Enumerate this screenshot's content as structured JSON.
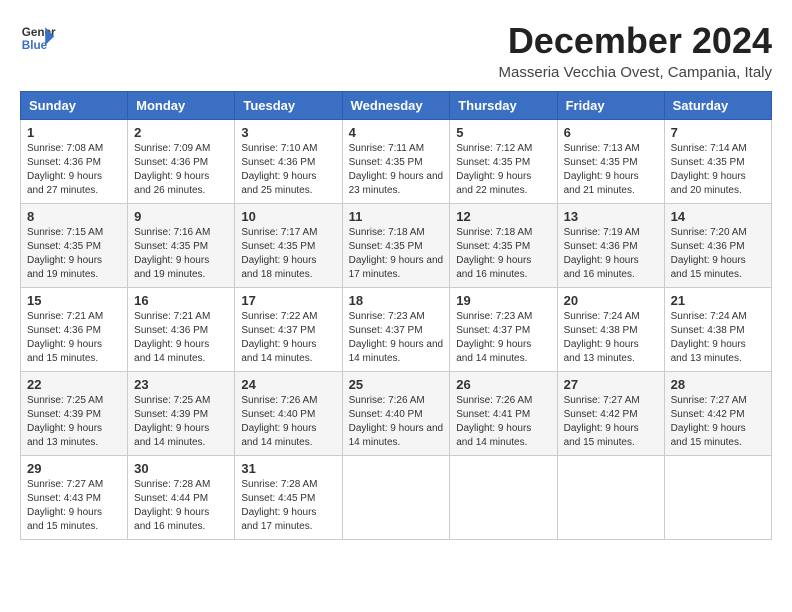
{
  "header": {
    "logo_line1": "General",
    "logo_line2": "Blue",
    "month": "December 2024",
    "location": "Masseria Vecchia Ovest, Campania, Italy"
  },
  "days_of_week": [
    "Sunday",
    "Monday",
    "Tuesday",
    "Wednesday",
    "Thursday",
    "Friday",
    "Saturday"
  ],
  "weeks": [
    [
      {
        "day": "1",
        "sunrise": "7:08 AM",
        "sunset": "4:36 PM",
        "daylight": "9 hours and 27 minutes."
      },
      {
        "day": "2",
        "sunrise": "7:09 AM",
        "sunset": "4:36 PM",
        "daylight": "9 hours and 26 minutes."
      },
      {
        "day": "3",
        "sunrise": "7:10 AM",
        "sunset": "4:36 PM",
        "daylight": "9 hours and 25 minutes."
      },
      {
        "day": "4",
        "sunrise": "7:11 AM",
        "sunset": "4:35 PM",
        "daylight": "9 hours and 23 minutes."
      },
      {
        "day": "5",
        "sunrise": "7:12 AM",
        "sunset": "4:35 PM",
        "daylight": "9 hours and 22 minutes."
      },
      {
        "day": "6",
        "sunrise": "7:13 AM",
        "sunset": "4:35 PM",
        "daylight": "9 hours and 21 minutes."
      },
      {
        "day": "7",
        "sunrise": "7:14 AM",
        "sunset": "4:35 PM",
        "daylight": "9 hours and 20 minutes."
      }
    ],
    [
      {
        "day": "8",
        "sunrise": "7:15 AM",
        "sunset": "4:35 PM",
        "daylight": "9 hours and 19 minutes."
      },
      {
        "day": "9",
        "sunrise": "7:16 AM",
        "sunset": "4:35 PM",
        "daylight": "9 hours and 19 minutes."
      },
      {
        "day": "10",
        "sunrise": "7:17 AM",
        "sunset": "4:35 PM",
        "daylight": "9 hours and 18 minutes."
      },
      {
        "day": "11",
        "sunrise": "7:18 AM",
        "sunset": "4:35 PM",
        "daylight": "9 hours and 17 minutes."
      },
      {
        "day": "12",
        "sunrise": "7:18 AM",
        "sunset": "4:35 PM",
        "daylight": "9 hours and 16 minutes."
      },
      {
        "day": "13",
        "sunrise": "7:19 AM",
        "sunset": "4:36 PM",
        "daylight": "9 hours and 16 minutes."
      },
      {
        "day": "14",
        "sunrise": "7:20 AM",
        "sunset": "4:36 PM",
        "daylight": "9 hours and 15 minutes."
      }
    ],
    [
      {
        "day": "15",
        "sunrise": "7:21 AM",
        "sunset": "4:36 PM",
        "daylight": "9 hours and 15 minutes."
      },
      {
        "day": "16",
        "sunrise": "7:21 AM",
        "sunset": "4:36 PM",
        "daylight": "9 hours and 14 minutes."
      },
      {
        "day": "17",
        "sunrise": "7:22 AM",
        "sunset": "4:37 PM",
        "daylight": "9 hours and 14 minutes."
      },
      {
        "day": "18",
        "sunrise": "7:23 AM",
        "sunset": "4:37 PM",
        "daylight": "9 hours and 14 minutes."
      },
      {
        "day": "19",
        "sunrise": "7:23 AM",
        "sunset": "4:37 PM",
        "daylight": "9 hours and 14 minutes."
      },
      {
        "day": "20",
        "sunrise": "7:24 AM",
        "sunset": "4:38 PM",
        "daylight": "9 hours and 13 minutes."
      },
      {
        "day": "21",
        "sunrise": "7:24 AM",
        "sunset": "4:38 PM",
        "daylight": "9 hours and 13 minutes."
      }
    ],
    [
      {
        "day": "22",
        "sunrise": "7:25 AM",
        "sunset": "4:39 PM",
        "daylight": "9 hours and 13 minutes."
      },
      {
        "day": "23",
        "sunrise": "7:25 AM",
        "sunset": "4:39 PM",
        "daylight": "9 hours and 14 minutes."
      },
      {
        "day": "24",
        "sunrise": "7:26 AM",
        "sunset": "4:40 PM",
        "daylight": "9 hours and 14 minutes."
      },
      {
        "day": "25",
        "sunrise": "7:26 AM",
        "sunset": "4:40 PM",
        "daylight": "9 hours and 14 minutes."
      },
      {
        "day": "26",
        "sunrise": "7:26 AM",
        "sunset": "4:41 PM",
        "daylight": "9 hours and 14 minutes."
      },
      {
        "day": "27",
        "sunrise": "7:27 AM",
        "sunset": "4:42 PM",
        "daylight": "9 hours and 15 minutes."
      },
      {
        "day": "28",
        "sunrise": "7:27 AM",
        "sunset": "4:42 PM",
        "daylight": "9 hours and 15 minutes."
      }
    ],
    [
      {
        "day": "29",
        "sunrise": "7:27 AM",
        "sunset": "4:43 PM",
        "daylight": "9 hours and 15 minutes."
      },
      {
        "day": "30",
        "sunrise": "7:28 AM",
        "sunset": "4:44 PM",
        "daylight": "9 hours and 16 minutes."
      },
      {
        "day": "31",
        "sunrise": "7:28 AM",
        "sunset": "4:45 PM",
        "daylight": "9 hours and 17 minutes."
      },
      null,
      null,
      null,
      null
    ]
  ]
}
